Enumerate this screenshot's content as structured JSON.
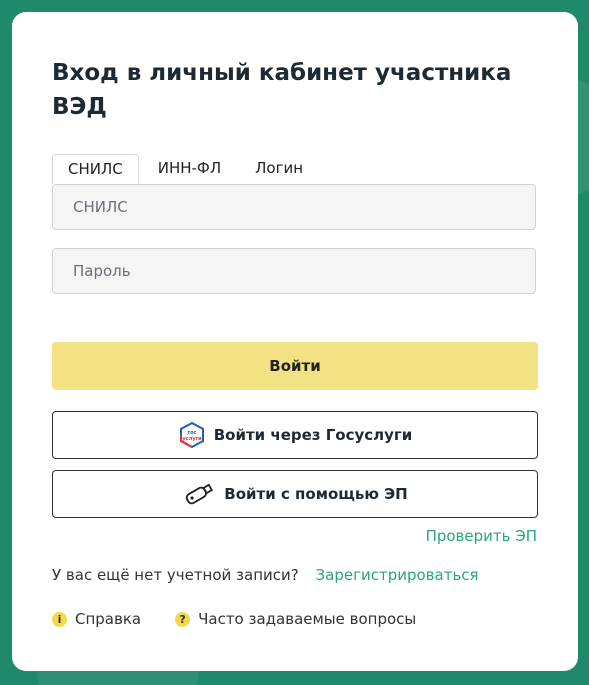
{
  "card": {
    "title": "Вход в личный кабинет участника ВЭД"
  },
  "tabs": [
    {
      "label": "СНИЛС",
      "active": true
    },
    {
      "label": "ИНН-ФЛ",
      "active": false
    },
    {
      "label": "Логин",
      "active": false
    }
  ],
  "form": {
    "snils_placeholder": "СНИЛС",
    "snils_value": "",
    "password_placeholder": "Пароль",
    "password_value": "",
    "login_button": "Войти",
    "gosuslugi_button": "Войти через Госуслуги",
    "gosuslugi_logo_text": "гос услуги",
    "ep_button": "Войти с помощью ЭП",
    "check_ep_link": "Проверить ЭП"
  },
  "register": {
    "prompt": "У вас ещё нет учетной записи?",
    "link": "Зарегистрироваться"
  },
  "footer": {
    "help": "Справка",
    "help_icon": "info-icon",
    "faq": "Часто задаваемые вопросы",
    "faq_icon": "question-icon"
  },
  "colors": {
    "background": "#1f8a6a",
    "primary_button": "#f3e283",
    "link": "#2aa57d",
    "footer_icon": "#f3d94a"
  }
}
